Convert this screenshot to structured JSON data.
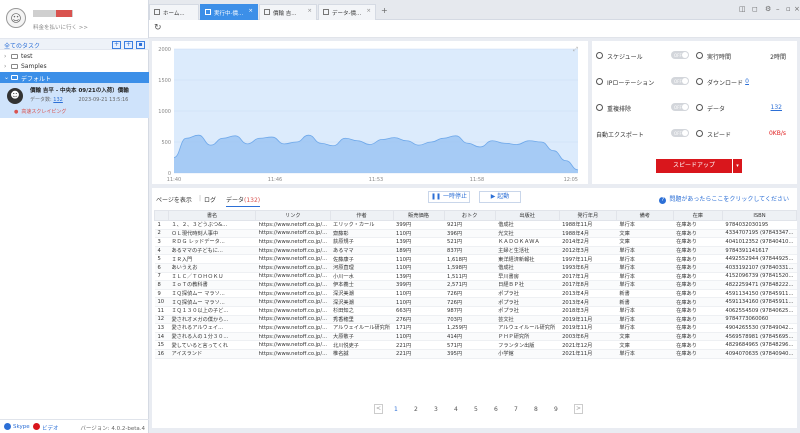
{
  "sidebar": {
    "link": "料金を払いに行く >>",
    "task_header": "全てのタスク",
    "tree": [
      {
        "label": "test"
      },
      {
        "label": "Samples"
      },
      {
        "label": "デフォルト"
      }
    ],
    "task": {
      "title": "價輸 吉平 - 中央本 09/21の入荷）價輸",
      "data_label": "データ数",
      "data_count": "132",
      "date": "2023-09-21 13:5:16",
      "tag": "高速スクレイピング"
    },
    "bottom": {
      "skype": "Skype",
      "video": "ビデオ",
      "version": "バージョン: 4.0.2-beta.4"
    }
  },
  "tabs": [
    {
      "label": "ホーム..."
    },
    {
      "label": "実行中-價..."
    },
    {
      "label": "價輸  吉..."
    },
    {
      "label": "データ-價..."
    }
  ],
  "chart_data": {
    "type": "area",
    "x_ticks": [
      "11:40",
      "11:46",
      "11:53",
      "11:58",
      "12:05"
    ],
    "y_ticks": [
      "0",
      "500",
      "1000",
      "1500",
      "2000"
    ],
    "ylim": [
      0,
      2000
    ],
    "series": [
      {
        "values": [
          250,
          560,
          610,
          450,
          560,
          600,
          470,
          560,
          580,
          470,
          500,
          610,
          480,
          440,
          560,
          520,
          460,
          540,
          570,
          520,
          450,
          500,
          560,
          600,
          480,
          420,
          520,
          480,
          460,
          520,
          500,
          360,
          200,
          50
        ]
      }
    ]
  },
  "stats": {
    "schedule": {
      "label": "スケジュール",
      "state": "OFF"
    },
    "runtime": {
      "label": "実行時間",
      "value": "2時間"
    },
    "ip_rotation": {
      "label": "IPローテーション",
      "state": "OFF"
    },
    "download": {
      "label": "ダウンロード",
      "value": "0"
    },
    "dedupe": {
      "label": "重複排除",
      "state": "OFF"
    },
    "data": {
      "label": "データ",
      "value": "132"
    },
    "auto_export": {
      "label": "自動エクスポート",
      "state": "OFF"
    },
    "speed": {
      "label": "スピード",
      "value": "0KB/s"
    },
    "speedup_label": "スピードアップ"
  },
  "controls": {
    "show_page": "ページを表示",
    "log": "ログ",
    "data_tab": "データ",
    "data_count": "(132)",
    "pause": "一時停止",
    "start": "起動",
    "help": "問題があったらここをクリックしてください"
  },
  "table": {
    "headers": [
      "",
      "書名",
      "リンク",
      "作者",
      "販売価格",
      "おトク",
      "出版社",
      "発行年月",
      "備考",
      "在庫",
      "ISBN"
    ],
    "rows": [
      [
        "1",
        "１、２、３どうぶつ&...",
        "https://www.netoff.co.jp/...",
        "エリック・カール",
        "399円",
        "921円",
        "偕成社",
        "1988年11月",
        "単行本",
        "在庫あり",
        "9784032030195"
      ],
      [
        "2",
        "ＯＬ現代時刻人事中",
        "https://www.netoff.co.jp/...",
        "齋藤彰",
        "110円",
        "396円",
        "光文社",
        "1988年4月",
        "文庫",
        "在庫あり",
        "4334707195 (97843347..."
      ],
      [
        "3",
        "ＲＤＧ レッドデータ...",
        "https://www.netoff.co.jp/...",
        "荻原規子",
        "139円",
        "521円",
        "ＫＡＤＯＫＡＷＡ",
        "2014年2月",
        "文庫",
        "在庫あり",
        "4041012352 (97840410..."
      ],
      [
        "4",
        "あるママの子どもに...",
        "https://www.netoff.co.jp/...",
        "あるママ",
        "189円",
        "837円",
        "主婦と生活社",
        "2012年3月",
        "単行本",
        "在庫あり",
        "9784391141617"
      ],
      [
        "5",
        "ＩＲ入門",
        "https://www.netoff.co.jp/...",
        "佐藤康子",
        "110円",
        "1,618円",
        "東洋経済新報社",
        "1997年11月",
        "単行本",
        "在庫あり",
        "4492552944 (97844925..."
      ],
      [
        "6",
        "あいうえお",
        "https://www.netoff.co.jp/...",
        "河原直理",
        "110円",
        "1,598円",
        "偕成社",
        "1993年6月",
        "単行本",
        "在庫あり",
        "4033192107 (97840331..."
      ],
      [
        "7",
        "ＩＬＣ／ＴＯＨＯＫＵ",
        "https://www.netoff.co.jp/...",
        "小川一水",
        "139円",
        "1,511円",
        "早川書房",
        "2017年1月",
        "単行本",
        "在庫あり",
        "4152096739 (97841520..."
      ],
      [
        "8",
        "ＩｏＴの教科書",
        "https://www.netoff.co.jp/...",
        "伊本義士",
        "399円",
        "2,571円",
        "日経ＢＰ社",
        "2017年8月",
        "単行本",
        "在庫あり",
        "4822259471 (97848222..."
      ],
      [
        "9",
        "ＩＱ探偵ムー マラソ...",
        "https://www.netoff.co.jp/...",
        "深沢美潮",
        "110円",
        "726円",
        "ポプラ社",
        "2013年4月",
        "新書",
        "在庫あり",
        "4591134150 (97845911..."
      ],
      [
        "10",
        "ＩＱ探偵ムー マラソ...",
        "https://www.netoff.co.jp/...",
        "深沢美潮",
        "110円",
        "726円",
        "ポプラ社",
        "2013年4月",
        "新書",
        "在庫あり",
        "4591134160 (97845911..."
      ],
      [
        "11",
        "ＩＱ１３０以上の子ど...",
        "https://www.netoff.co.jp/...",
        "杉田知之",
        "663円",
        "987円",
        "ポプラ社",
        "2018年3月",
        "単行本",
        "在庫あり",
        "4062554509 (97840625..."
      ],
      [
        "12",
        "愛されオメガの僕から...",
        "https://www.netoff.co.jp/...",
        "秀香穂里",
        "276円",
        "703円",
        "芸文社",
        "2019年11月",
        "単行本",
        "在庫あり",
        "9784773060060"
      ],
      [
        "13",
        "愛されるアルウェイ...",
        "https://www.netoff.co.jp/...",
        "アルウェイルール研究所",
        "171円",
        "1,259円",
        "アルウェイルール研究所",
        "2019年11月",
        "単行本",
        "在庫あり",
        "4904265530 (97849042..."
      ],
      [
        "14",
        "愛される人の１分３０...",
        "https://www.netoff.co.jp/...",
        "大原敬子",
        "110円",
        "414円",
        "ＰＨＰ研究所",
        "2003年6月",
        "文庫",
        "在庫あり",
        "4569578981 (97845695..."
      ],
      [
        "15",
        "愛していると言ってくれ",
        "https://www.netoff.co.jp/...",
        "北川悦吏子",
        "221円",
        "571円",
        "フランタン出版",
        "2021年12月",
        "文庫",
        "在庫あり",
        "4829684965 (97848296..."
      ],
      [
        "16",
        "アイスランド",
        "https://www.netoff.co.jp/...",
        "椎名誠",
        "221円",
        "395円",
        "小学館",
        "2021年11月",
        "単行本",
        "在庫あり",
        "4094070635 (97840940..."
      ]
    ]
  },
  "pager": {
    "pages": [
      "1",
      "2",
      "3",
      "4",
      "5",
      "6",
      "7",
      "8",
      "9"
    ],
    "prev": "<",
    "next": ">"
  }
}
